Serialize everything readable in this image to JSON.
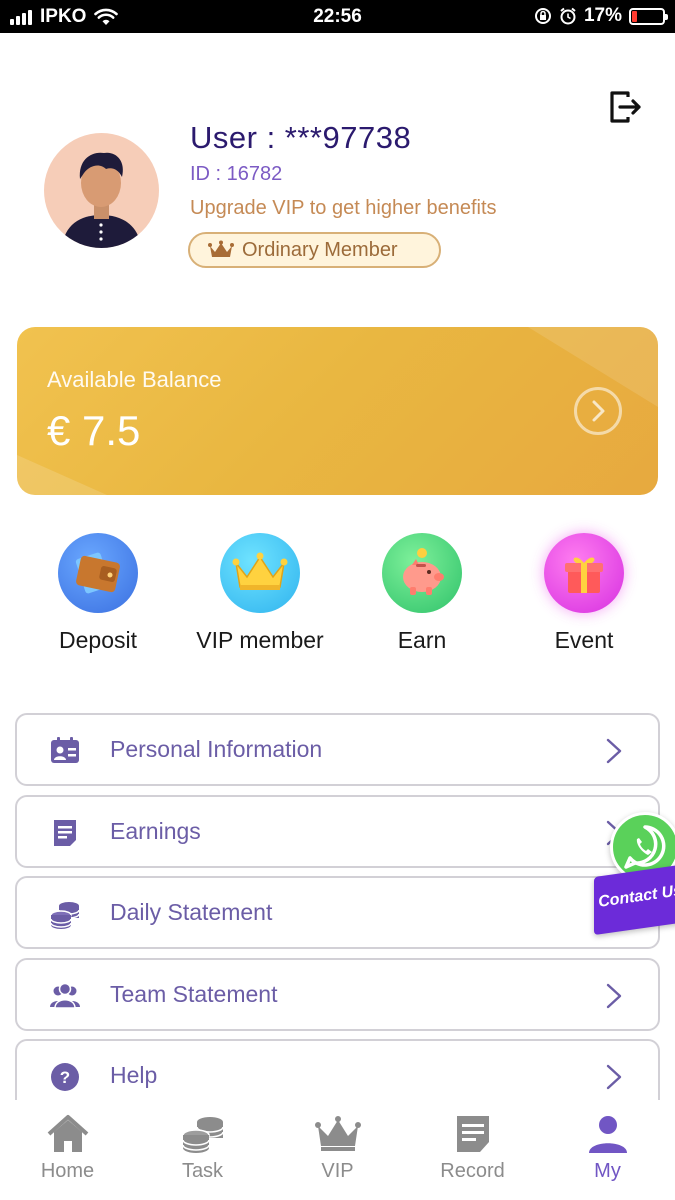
{
  "status_bar": {
    "carrier": "IPKO",
    "time": "22:56",
    "battery": "17%",
    "battery_level": 0.17
  },
  "profile": {
    "user_title": "User : ***97738",
    "user_id": "ID : 16782",
    "upgrade_text": "Upgrade VIP to get higher benefits",
    "member_level": "Ordinary Member"
  },
  "balance": {
    "label": "Available Balance",
    "value": "€ 7.5"
  },
  "quick_actions": [
    {
      "label": "Deposit",
      "icon": "wallet-icon"
    },
    {
      "label": "VIP member",
      "icon": "crown-icon"
    },
    {
      "label": "Earn",
      "icon": "piggy-bank-icon"
    },
    {
      "label": "Event",
      "icon": "gift-icon"
    }
  ],
  "menu": [
    {
      "label": "Personal Information",
      "icon": "id-card-icon"
    },
    {
      "label": "Earnings",
      "icon": "document-icon"
    },
    {
      "label": "Daily Statement",
      "icon": "coins-icon"
    },
    {
      "label": "Team Statement",
      "icon": "team-icon"
    },
    {
      "label": "Help",
      "icon": "help-icon"
    }
  ],
  "contact": {
    "label": "Contact Us"
  },
  "bottom_nav": [
    {
      "label": "Home",
      "icon": "home-icon",
      "active": false
    },
    {
      "label": "Task",
      "icon": "coins-icon",
      "active": false
    },
    {
      "label": "VIP",
      "icon": "crown-icon",
      "active": false
    },
    {
      "label": "Record",
      "icon": "document-icon",
      "active": false
    },
    {
      "label": "My",
      "icon": "person-icon",
      "active": true
    }
  ],
  "colors": {
    "accent": "#7156c4",
    "balance_card": "#e9b741",
    "title": "#2b1a6e",
    "upgrade_text": "#c58a55"
  }
}
